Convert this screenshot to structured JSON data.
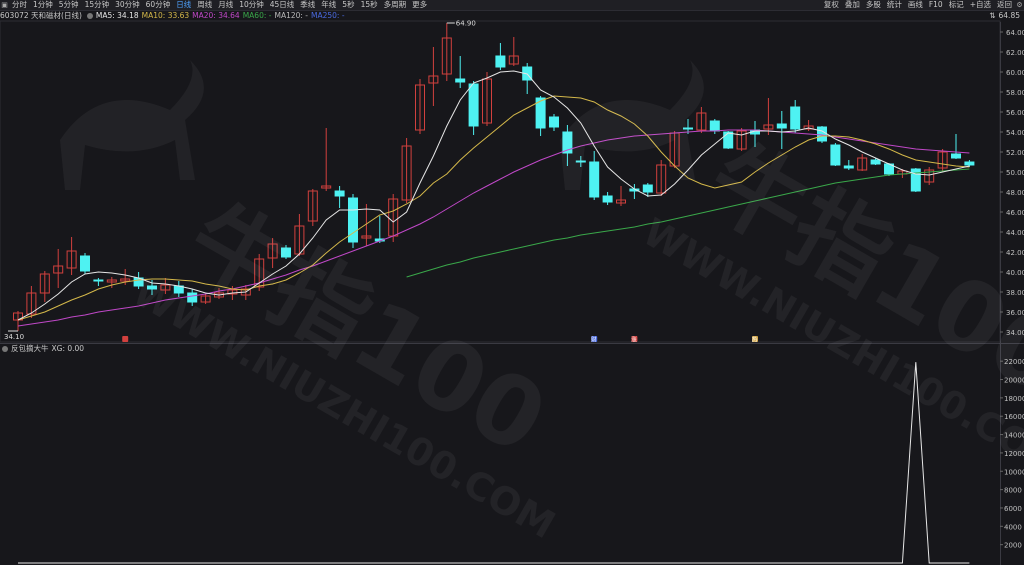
{
  "toolbar": {
    "left_tabs": [
      {
        "label": "分时",
        "active": false
      },
      {
        "label": "1分钟",
        "active": false
      },
      {
        "label": "5分钟",
        "active": false
      },
      {
        "label": "15分钟",
        "active": false
      },
      {
        "label": "30分钟",
        "active": false
      },
      {
        "label": "60分钟",
        "active": false
      },
      {
        "label": "日线",
        "active": true
      },
      {
        "label": "周线",
        "active": false
      },
      {
        "label": "月线",
        "active": false
      },
      {
        "label": "10分钟",
        "active": false
      },
      {
        "label": "45日线",
        "active": false
      },
      {
        "label": "季线",
        "active": false
      },
      {
        "label": "年线",
        "active": false
      },
      {
        "label": "5秒",
        "active": false
      },
      {
        "label": "15秒",
        "active": false
      },
      {
        "label": "多周期",
        "active": false
      },
      {
        "label": "更多",
        "active": false
      }
    ],
    "right_tabs": [
      "复权",
      "叠加",
      "多股",
      "统计",
      "画线",
      "F10",
      "标记",
      "+自选",
      "返回"
    ]
  },
  "stock": {
    "code_name": "603072 天和磁材(日线)",
    "ma_labels": [
      {
        "text": "MA5: 34.18",
        "color": "#e6e6e6"
      },
      {
        "text": "MA10: 33.63",
        "color": "#d4b84a"
      },
      {
        "text": "MA20: 34.64",
        "color": "#c048c8"
      },
      {
        "text": "MA60: -",
        "color": "#3aa84a"
      },
      {
        "text": "MA120: -",
        "color": "#b8b8b8"
      },
      {
        "text": "MA250: -",
        "color": "#4a6ae0"
      }
    ],
    "top_right_price": "64.85"
  },
  "indicator": {
    "name": "反包摘大牛",
    "value_label": "XG: 0.00"
  },
  "colors": {
    "up": "#d2403e",
    "down": "#4ef2f2",
    "bg": "#17171b",
    "grid": "#2a2a30"
  },
  "markers": [
    {
      "label": "财",
      "color": "#4a6ae0"
    },
    {
      "label": "涨",
      "color": "#d2403e"
    },
    {
      "label": "热",
      "color": "#d4a84a"
    }
  ],
  "watermark": {
    "brand": "牛指100",
    "url": "WWW.NIUZHI100.COM"
  },
  "chart_data": [
    {
      "type": "candlestick",
      "title": "603072 天和磁材(日线)",
      "ylim": [
        33,
        65
      ],
      "yticks": [
        34,
        36,
        38,
        40,
        42,
        44,
        46,
        48,
        50,
        52,
        54,
        56,
        58,
        60,
        62,
        64
      ],
      "annotations": [
        {
          "text": "64.90",
          "kind": "period-high"
        },
        {
          "text": "34.10",
          "kind": "period-low"
        }
      ],
      "candles": [
        {
          "o": 35.2,
          "h": 36.1,
          "l": 34.1,
          "c": 35.9
        },
        {
          "o": 35.8,
          "h": 38.6,
          "l": 35.4,
          "c": 37.9
        },
        {
          "o": 37.9,
          "h": 40.1,
          "l": 37.0,
          "c": 39.8
        },
        {
          "o": 39.9,
          "h": 42.3,
          "l": 38.4,
          "c": 40.6
        },
        {
          "o": 40.4,
          "h": 43.5,
          "l": 39.7,
          "c": 42.1
        },
        {
          "o": 41.6,
          "h": 41.9,
          "l": 39.8,
          "c": 40.1
        },
        {
          "o": 39.2,
          "h": 39.4,
          "l": 38.6,
          "c": 39.1
        },
        {
          "o": 39.0,
          "h": 39.5,
          "l": 38.4,
          "c": 39.2
        },
        {
          "o": 39.1,
          "h": 40.3,
          "l": 38.7,
          "c": 39.3
        },
        {
          "o": 39.4,
          "h": 40.0,
          "l": 38.3,
          "c": 38.6
        },
        {
          "o": 38.6,
          "h": 39.2,
          "l": 37.7,
          "c": 38.3
        },
        {
          "o": 38.2,
          "h": 39.4,
          "l": 37.8,
          "c": 38.7
        },
        {
          "o": 38.6,
          "h": 39.1,
          "l": 37.5,
          "c": 37.9
        },
        {
          "o": 37.9,
          "h": 38.3,
          "l": 36.6,
          "c": 37.0
        },
        {
          "o": 37.0,
          "h": 37.8,
          "l": 36.8,
          "c": 37.6
        },
        {
          "o": 37.5,
          "h": 38.4,
          "l": 37.3,
          "c": 37.9
        },
        {
          "o": 37.8,
          "h": 38.6,
          "l": 37.2,
          "c": 38.2
        },
        {
          "o": 37.7,
          "h": 38.7,
          "l": 37.2,
          "c": 38.3
        },
        {
          "o": 38.5,
          "h": 41.8,
          "l": 38.1,
          "c": 41.3
        },
        {
          "o": 41.4,
          "h": 43.4,
          "l": 40.4,
          "c": 42.8
        },
        {
          "o": 42.4,
          "h": 42.7,
          "l": 41.3,
          "c": 41.5
        },
        {
          "o": 41.8,
          "h": 45.8,
          "l": 41.6,
          "c": 44.6
        },
        {
          "o": 45.1,
          "h": 48.3,
          "l": 44.6,
          "c": 48.1
        },
        {
          "o": 48.4,
          "h": 54.4,
          "l": 48.1,
          "c": 48.6
        },
        {
          "o": 48.1,
          "h": 48.6,
          "l": 46.4,
          "c": 47.6
        },
        {
          "o": 47.4,
          "h": 47.8,
          "l": 42.4,
          "c": 43.0
        },
        {
          "o": 43.4,
          "h": 46.8,
          "l": 42.6,
          "c": 43.6
        },
        {
          "o": 43.3,
          "h": 45.6,
          "l": 42.9,
          "c": 43.1
        },
        {
          "o": 43.6,
          "h": 47.8,
          "l": 43.0,
          "c": 47.3
        },
        {
          "o": 47.2,
          "h": 53.4,
          "l": 46.9,
          "c": 52.6
        },
        {
          "o": 54.2,
          "h": 59.3,
          "l": 53.8,
          "c": 58.7
        },
        {
          "o": 58.9,
          "h": 62.5,
          "l": 56.6,
          "c": 59.6
        },
        {
          "o": 59.8,
          "h": 64.9,
          "l": 59.1,
          "c": 63.4
        },
        {
          "o": 59.3,
          "h": 61.6,
          "l": 58.4,
          "c": 59.0
        },
        {
          "o": 58.8,
          "h": 59.1,
          "l": 53.7,
          "c": 54.6
        },
        {
          "o": 54.9,
          "h": 60.0,
          "l": 54.6,
          "c": 59.3
        },
        {
          "o": 61.6,
          "h": 62.9,
          "l": 60.2,
          "c": 60.5
        },
        {
          "o": 60.8,
          "h": 63.5,
          "l": 60.6,
          "c": 61.6
        },
        {
          "o": 60.5,
          "h": 60.9,
          "l": 57.8,
          "c": 59.2
        },
        {
          "o": 57.4,
          "h": 57.6,
          "l": 53.6,
          "c": 54.4
        },
        {
          "o": 55.5,
          "h": 55.8,
          "l": 54.1,
          "c": 54.5
        },
        {
          "o": 54.0,
          "h": 54.7,
          "l": 50.6,
          "c": 51.9
        },
        {
          "o": 51.1,
          "h": 51.6,
          "l": 50.5,
          "c": 51.0
        },
        {
          "o": 51.0,
          "h": 52.1,
          "l": 47.2,
          "c": 47.5
        },
        {
          "o": 47.6,
          "h": 48.0,
          "l": 46.7,
          "c": 47.0
        },
        {
          "o": 46.9,
          "h": 48.6,
          "l": 46.6,
          "c": 47.2
        },
        {
          "o": 48.3,
          "h": 48.8,
          "l": 47.3,
          "c": 48.1
        },
        {
          "o": 48.7,
          "h": 48.9,
          "l": 47.5,
          "c": 48.0
        },
        {
          "o": 47.9,
          "h": 51.2,
          "l": 47.6,
          "c": 50.7
        },
        {
          "o": 50.6,
          "h": 54.1,
          "l": 50.4,
          "c": 53.9
        },
        {
          "o": 54.4,
          "h": 55.3,
          "l": 53.8,
          "c": 54.3
        },
        {
          "o": 54.2,
          "h": 56.5,
          "l": 53.9,
          "c": 55.9
        },
        {
          "o": 55.1,
          "h": 55.3,
          "l": 53.8,
          "c": 54.1
        },
        {
          "o": 54.0,
          "h": 54.1,
          "l": 52.3,
          "c": 52.4
        },
        {
          "o": 52.3,
          "h": 54.4,
          "l": 52.1,
          "c": 54.1
        },
        {
          "o": 54.2,
          "h": 55.1,
          "l": 52.5,
          "c": 53.8
        },
        {
          "o": 54.3,
          "h": 57.4,
          "l": 53.7,
          "c": 54.7
        },
        {
          "o": 54.8,
          "h": 56.1,
          "l": 52.3,
          "c": 54.4
        },
        {
          "o": 56.5,
          "h": 57.2,
          "l": 53.9,
          "c": 54.3
        },
        {
          "o": 54.3,
          "h": 55.2,
          "l": 54.1,
          "c": 54.6
        },
        {
          "o": 54.5,
          "h": 54.6,
          "l": 52.9,
          "c": 53.1
        },
        {
          "o": 52.7,
          "h": 52.9,
          "l": 50.6,
          "c": 50.7
        },
        {
          "o": 50.6,
          "h": 51.2,
          "l": 50.2,
          "c": 50.4
        },
        {
          "o": 50.2,
          "h": 51.8,
          "l": 50.1,
          "c": 51.4
        },
        {
          "o": 51.2,
          "h": 51.4,
          "l": 50.7,
          "c": 50.8
        },
        {
          "o": 50.8,
          "h": 50.9,
          "l": 49.6,
          "c": 49.8
        },
        {
          "o": 49.8,
          "h": 50.3,
          "l": 49.4,
          "c": 50.1
        },
        {
          "o": 50.3,
          "h": 50.4,
          "l": 48.0,
          "c": 48.1
        },
        {
          "o": 49.0,
          "h": 50.5,
          "l": 48.7,
          "c": 50.2
        },
        {
          "o": 50.4,
          "h": 52.3,
          "l": 50.0,
          "c": 52.0
        },
        {
          "o": 51.8,
          "h": 53.8,
          "l": 51.3,
          "c": 51.4
        },
        {
          "o": 51.0,
          "h": 51.2,
          "l": 50.5,
          "c": 50.7
        }
      ],
      "ma5": [
        35.2,
        35.9,
        36.8,
        37.8,
        39.0,
        39.8,
        40.0,
        39.9,
        39.7,
        39.4,
        38.9,
        38.8,
        38.6,
        38.3,
        37.9,
        37.7,
        37.9,
        38.0,
        38.9,
        39.8,
        40.6,
        41.8,
        43.4,
        45.2,
        46.2,
        46.2,
        46.3,
        46.2,
        45.0,
        46.0,
        48.9,
        51.6,
        54.6,
        57.2,
        58.9,
        59.4,
        60.0,
        60.1,
        59.8,
        58.2,
        57.5,
        56.4,
        54.9,
        52.6,
        50.5,
        49.3,
        48.3,
        47.6,
        47.7,
        48.8,
        50.2,
        51.7,
        52.8,
        53.9,
        53.7,
        54.1,
        54.1,
        54.0,
        54.1,
        54.4,
        54.1,
        53.3,
        52.7,
        52.0,
        51.4,
        50.8,
        50.2,
        49.8,
        49.7,
        50.0,
        50.3,
        50.6
      ],
      "ma10": [
        35.2,
        35.6,
        36.0,
        36.6,
        37.2,
        37.7,
        38.3,
        38.7,
        39.0,
        39.2,
        39.3,
        39.3,
        39.2,
        39.1,
        38.8,
        38.6,
        38.3,
        38.2,
        38.6,
        38.8,
        39.2,
        39.9,
        40.7,
        41.9,
        43.0,
        43.9,
        44.8,
        45.7,
        46.1,
        46.8,
        47.6,
        48.9,
        49.8,
        51.2,
        52.4,
        53.5,
        54.6,
        55.7,
        56.4,
        57.1,
        57.6,
        57.5,
        57.4,
        57.0,
        56.2,
        55.6,
        54.8,
        53.6,
        52.0,
        50.6,
        49.4,
        48.8,
        48.4,
        48.7,
        49.0,
        50.0,
        50.9,
        51.7,
        52.5,
        53.2,
        53.6,
        53.6,
        53.5,
        53.2,
        52.8,
        52.3,
        51.7,
        51.2,
        51.0,
        50.8,
        50.6,
        50.5
      ],
      "ma20": [
        34.6,
        34.8,
        35.0,
        35.2,
        35.5,
        35.7,
        36.0,
        36.2,
        36.4,
        36.6,
        36.9,
        37.2,
        37.4,
        37.6,
        37.8,
        38.1,
        38.3,
        38.6,
        38.9,
        39.3,
        39.7,
        40.2,
        40.6,
        41.1,
        41.6,
        42.1,
        42.6,
        43.1,
        43.6,
        44.2,
        44.8,
        45.5,
        46.3,
        47.1,
        47.9,
        48.6,
        49.3,
        50.0,
        50.6,
        51.2,
        51.7,
        52.2,
        52.6,
        52.9,
        53.2,
        53.4,
        53.6,
        53.7,
        53.8,
        53.9,
        54.0,
        54.1,
        54.1,
        54.2,
        54.2,
        54.2,
        54.1,
        54.0,
        53.9,
        53.8,
        53.7,
        53.5,
        53.3,
        53.1,
        52.9,
        52.7,
        52.5,
        52.3,
        52.2,
        52.1,
        52.0,
        51.9
      ],
      "ma60": [
        null,
        null,
        null,
        null,
        null,
        null,
        null,
        null,
        null,
        null,
        null,
        null,
        null,
        null,
        null,
        null,
        null,
        null,
        null,
        null,
        null,
        null,
        null,
        null,
        null,
        null,
        null,
        null,
        null,
        39.5,
        39.9,
        40.3,
        40.7,
        41.0,
        41.4,
        41.7,
        42.0,
        42.3,
        42.6,
        42.9,
        43.2,
        43.4,
        43.7,
        43.9,
        44.1,
        44.3,
        44.5,
        44.8,
        45.0,
        45.3,
        45.6,
        45.9,
        46.2,
        46.5,
        46.8,
        47.1,
        47.4,
        47.7,
        48.0,
        48.3,
        48.6,
        48.9,
        49.1,
        49.3,
        49.5,
        49.7,
        49.8,
        49.9,
        50.0,
        50.1,
        50.2,
        50.3
      ]
    },
    {
      "type": "line",
      "title": "反包摘大牛",
      "ylim": [
        0,
        23000
      ],
      "yticks": [
        2000,
        4000,
        6000,
        8000,
        10000,
        12000,
        14000,
        16000,
        18000,
        20000,
        22000
      ],
      "series": [
        {
          "name": "XG",
          "values": [
            0,
            0,
            0,
            0,
            0,
            0,
            0,
            0,
            0,
            0,
            0,
            0,
            0,
            0,
            0,
            0,
            0,
            0,
            0,
            0,
            0,
            0,
            0,
            0,
            0,
            0,
            0,
            0,
            0,
            0,
            0,
            0,
            0,
            0,
            0,
            0,
            0,
            0,
            0,
            0,
            0,
            0,
            0,
            0,
            0,
            0,
            0,
            0,
            0,
            0,
            0,
            0,
            0,
            0,
            0,
            0,
            0,
            0,
            0,
            0,
            0,
            0,
            0,
            0,
            0,
            0,
            0,
            21900,
            0,
            0,
            0,
            0
          ]
        }
      ]
    }
  ]
}
